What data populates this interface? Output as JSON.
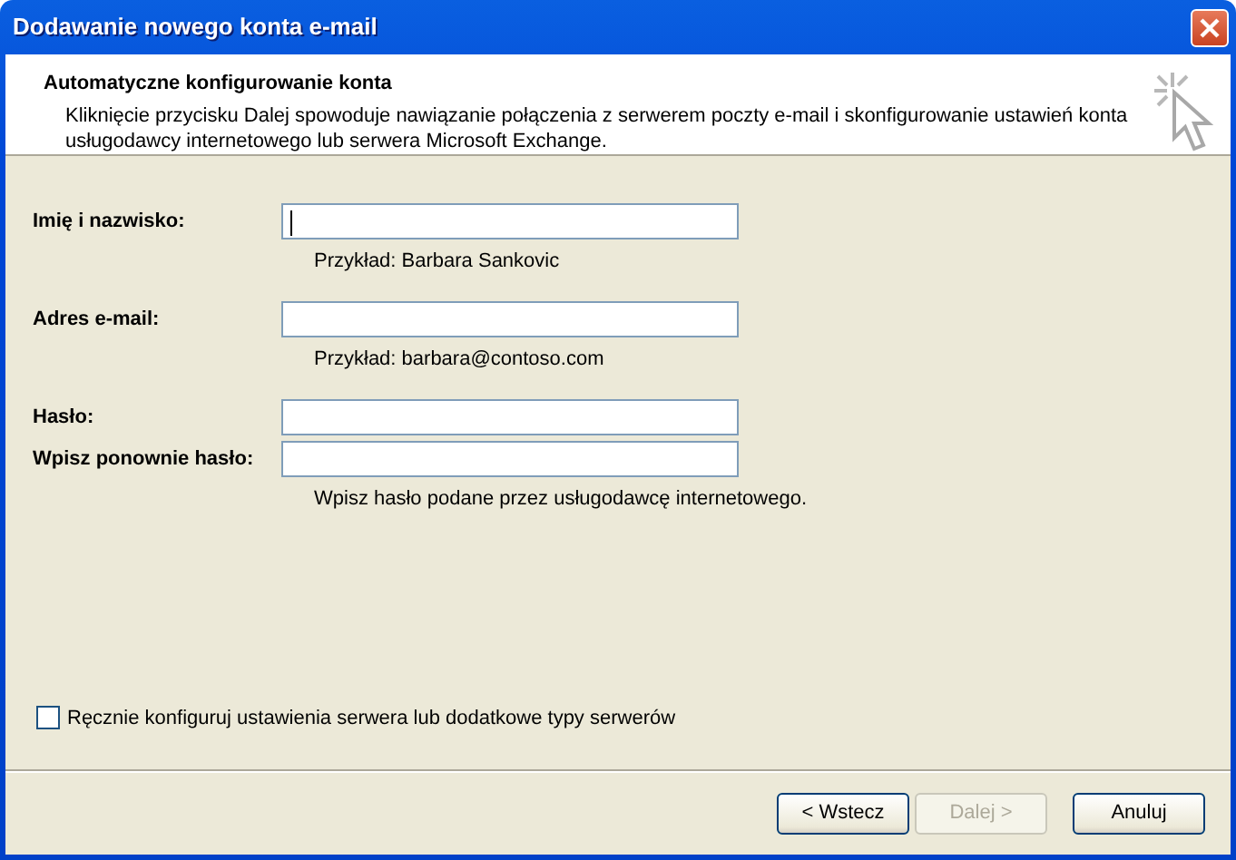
{
  "window": {
    "title": "Dodawanie nowego konta e-mail"
  },
  "header": {
    "title": "Automatyczne konfigurowanie konta",
    "description": "Kliknięcie przycisku Dalej spowoduje nawiązanie połączenia z serwerem poczty e-mail i skonfigurowanie ustawień konta usługodawcy internetowego lub serwera Microsoft Exchange."
  },
  "fields": [
    {
      "label": "Imię i nazwisko:",
      "focused": true,
      "hint": "Przykład: Barbara Sankovic"
    },
    {
      "label": "Adres e-mail:",
      "focused": false,
      "hint": "Przykład: barbara@contoso.com"
    },
    {
      "label": "Hasło:",
      "focused": false
    },
    {
      "label": "Wpisz ponownie hasło:",
      "focused": false,
      "hint": "Wpisz hasło podane przez usługodawcę internetowego."
    }
  ],
  "manual_config": {
    "label": "Ręcznie konfiguruj ustawienia serwera lub dodatkowe typy serwerów",
    "checked": false
  },
  "buttons": [
    {
      "label": "< Wstecz",
      "disabled": false
    },
    {
      "label": "Dalej >",
      "disabled": true
    },
    {
      "label": "Anuluj",
      "disabled": false
    }
  ]
}
